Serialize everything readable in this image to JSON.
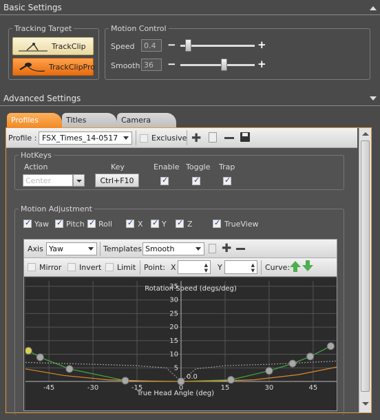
{
  "basic": {
    "title": "Basic Settings",
    "tracking_target": {
      "title": "Tracking Target",
      "buttons": [
        "TrackClip",
        "TrackClipPro"
      ]
    },
    "motion_control": {
      "title": "Motion Control",
      "speed_label": "Speed",
      "speed_value": "0.4",
      "speed_level": 0.1,
      "smooth_label": "Smooth",
      "smooth_value": "36",
      "smooth_level": 0.58
    }
  },
  "advanced": {
    "title": "Advanced Settings",
    "tabs": [
      "Profiles",
      "Titles",
      "Camera"
    ],
    "profile_bar": {
      "label": "Profile :",
      "selected": "FSX_Times_14-0517",
      "exclusive_label": "Exclusive"
    },
    "hotkeys": {
      "title": "HotKeys",
      "headers": [
        "Action",
        "Key",
        "Enable",
        "Toggle",
        "Trap"
      ],
      "action_placeholder": "Center",
      "key_value": "Ctrl+F10"
    },
    "motion": {
      "title": "Motion Adjustment",
      "axes": [
        "Yaw",
        "Pitch",
        "Roll",
        "X",
        "Y",
        "Z",
        "TrueView"
      ],
      "toolbar": {
        "axis_label": "Axis",
        "axis_value": "Yaw",
        "templates_label": "Templates",
        "templates_value": "Smooth",
        "mirror_label": "Mirror",
        "invert_label": "Invert",
        "limit_label": "Limit",
        "point_label": "Point:",
        "x_label": "X",
        "y_label": "Y",
        "curve_label": "Curve:"
      }
    }
  },
  "chart_data": {
    "type": "line",
    "title": "Rotation Speed (degs/deg)",
    "xlabel": "True Head Angle (deg)",
    "ylabel": "",
    "xlim": [
      -53,
      53
    ],
    "ylim": [
      0,
      37
    ],
    "x_ticks": [
      -45,
      -30,
      -15,
      0,
      15,
      30,
      45
    ],
    "y_ticks": [
      0,
      5,
      10,
      15,
      20,
      25,
      30,
      35
    ],
    "current_readout": "0.0",
    "series": [
      {
        "color": "#3fae3f",
        "points": [
          [
            -52,
            11.3
          ],
          [
            -48,
            8.9
          ],
          [
            -38,
            4.6
          ],
          [
            -19,
            0.3
          ],
          [
            0,
            0
          ],
          [
            17,
            0.6
          ],
          [
            30,
            3.9
          ],
          [
            38,
            6.6
          ],
          [
            44,
            9.2
          ],
          [
            51,
            13
          ]
        ]
      },
      {
        "color": "#e08a2a",
        "points": [
          [
            -53,
            4.6
          ],
          [
            -40,
            2.2
          ],
          [
            -25,
            0.6
          ],
          [
            -10,
            0.1
          ],
          [
            0,
            0
          ],
          [
            10,
            0.1
          ],
          [
            25,
            0.6
          ],
          [
            40,
            2.5
          ],
          [
            53,
            5.3
          ]
        ]
      },
      {
        "color": "#9a9a9a",
        "points": [
          [
            -53,
            7.0
          ],
          [
            -30,
            6.3
          ],
          [
            -15,
            5.8
          ],
          [
            -5,
            5.0
          ],
          [
            0,
            0
          ],
          [
            5,
            4.6
          ],
          [
            15,
            5.8
          ],
          [
            30,
            6.3
          ],
          [
            53,
            7.5
          ]
        ]
      }
    ],
    "control_points": [
      [
        -52,
        11.3
      ],
      [
        -48,
        8.9
      ],
      [
        -38,
        4.6
      ],
      [
        -19,
        0.3
      ],
      [
        0,
        0
      ],
      [
        17,
        0.6
      ],
      [
        30,
        3.9
      ],
      [
        38,
        6.6
      ],
      [
        44,
        9.2
      ],
      [
        51,
        13
      ]
    ],
    "grid": true
  }
}
